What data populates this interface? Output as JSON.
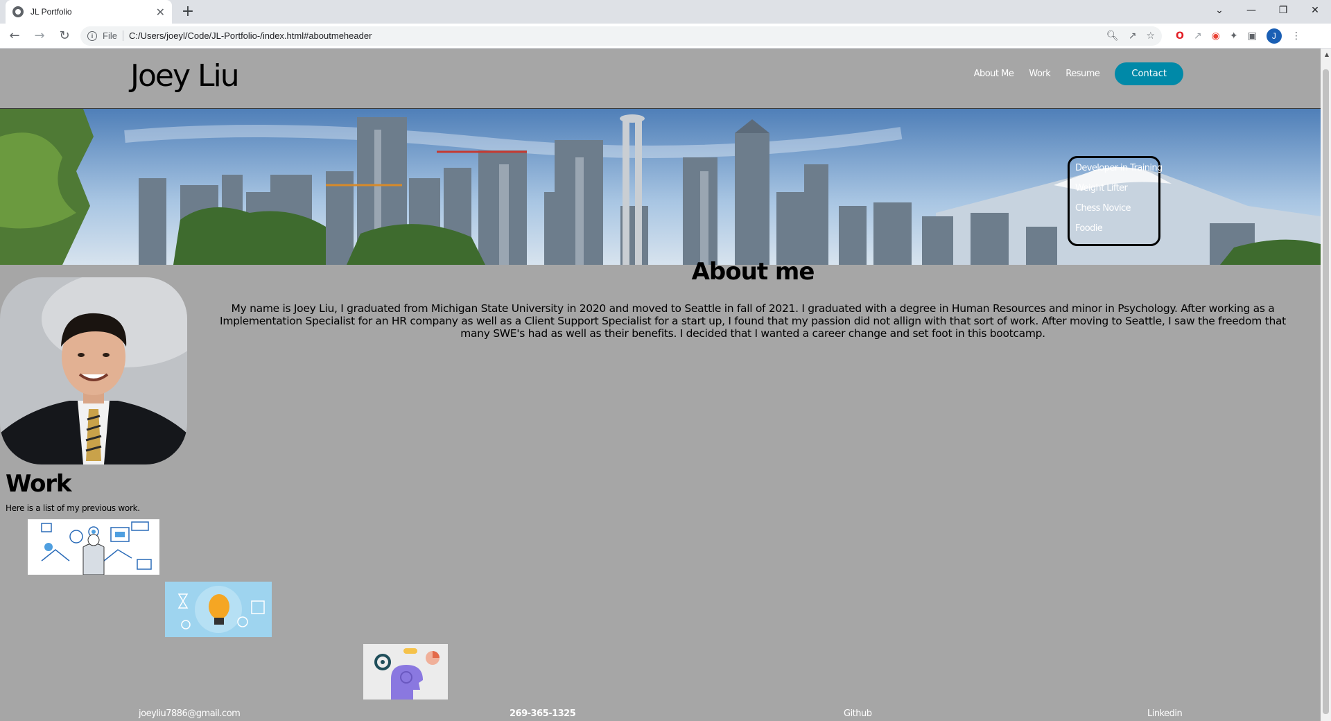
{
  "browser": {
    "tab_title": "JL Portfolio",
    "tab_close": "✕",
    "new_tab": "+",
    "window_controls": [
      "⌄",
      "—",
      "❐",
      "✕"
    ],
    "nav": {
      "back": "←",
      "forward": "→",
      "reload": "↻"
    },
    "address": {
      "scheme_label": "File",
      "url": "C:/Users/joeyl/Code/JL-Portfolio-/index.html#aboutmeheader"
    },
    "profile_initial": "J"
  },
  "site": {
    "logo": "Joey Liu",
    "nav": {
      "about": "About Me",
      "work": "Work",
      "resume": "Resume",
      "contact": "Contact"
    },
    "taglines": [
      "Developer in Training",
      "Weight Lifter",
      "Chess Novice",
      "Foodie"
    ],
    "about": {
      "title": "About me",
      "text": "My name is Joey Liu, I graduated from Michigan State University in 2020 and moved to Seattle in fall of 2021. I graduated with a degree in Human Resources and minor in Psychology. After working as a Implementation Specialist for an HR company as well as a Client Support Specialist for a start up, I found that my passion did not allign with that sort of work. After moving to Seattle, I saw the freedom that many SWE's had as well as their benefits. I decided that I wanted a career change and set foot in this bootcamp."
    },
    "work": {
      "title": "Work",
      "intro": "Here is a list of my previous work."
    },
    "footer": {
      "email": "joeyliu7886@gmail.com",
      "phone": "269-365-1325",
      "github": "Github",
      "linkedin": "Linkedin"
    }
  },
  "colors": {
    "page_bg": "#a6a6a6",
    "contact_button": "#0089a8",
    "text_light": "#ffffff"
  }
}
